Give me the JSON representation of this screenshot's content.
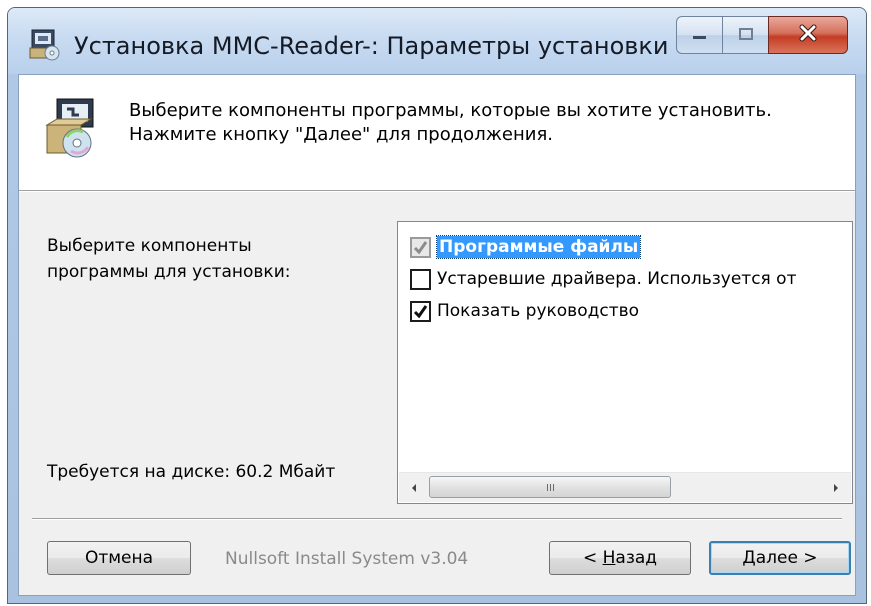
{
  "window": {
    "title": "Установка MMC-Reader-: Параметры установки",
    "title_color": "#141b26"
  },
  "header": {
    "line1": "Выберите компоненты программы, которые вы хотите установить.",
    "line2": "Нажмите кнопку \"Далее\" для продолжения."
  },
  "left": {
    "label_line1": "Выберите компоненты",
    "label_line2": "программы для установки:",
    "disk_required": "Требуется на диске: 60.2 Мбайт"
  },
  "components": [
    {
      "label": "Программые файлы",
      "checked": true,
      "disabled": true,
      "selected": true
    },
    {
      "label": "Устаревшие драйвера. Используется от",
      "checked": false,
      "disabled": false,
      "selected": false
    },
    {
      "label": "Показать руководство",
      "checked": true,
      "disabled": false,
      "selected": false
    }
  ],
  "footer": {
    "branding": "Nullsoft Install System v3.04",
    "cancel_label": "Отмена",
    "back_prefix": "< ",
    "back_mnemonic": "Н",
    "back_rest": "азад",
    "next_mnemonic": "Д",
    "next_rest": "алее >"
  },
  "icons": {
    "app": "installer-icon",
    "header": "software-box-cd-icon",
    "minimize": "minimize-icon",
    "maximize": "maximize-icon",
    "close": "close-icon",
    "scroll_left": "arrow-left-icon",
    "scroll_right": "arrow-right-icon"
  },
  "colors": {
    "selection": "#3399ff",
    "close_button": "#c43d24",
    "default_button_border": "#3c7fb1"
  }
}
